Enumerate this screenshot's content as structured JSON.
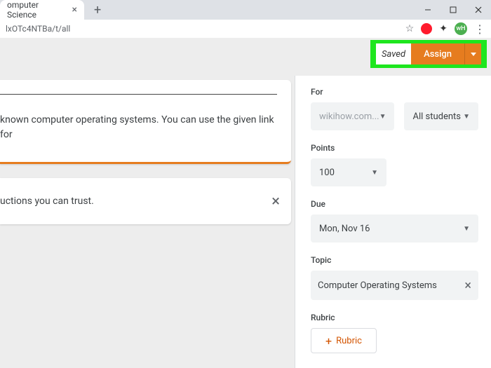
{
  "browser": {
    "tab_title": "omputer Science",
    "url_fragment": "lxOTc4NTBa/t/all",
    "avatar_initials": "wH"
  },
  "header": {
    "saved_label": "Saved",
    "assign_label": "Assign"
  },
  "left": {
    "instructions": "known computer operating systems. You can use the given link for",
    "trust_text": "uctions you can trust."
  },
  "right": {
    "for_label": "For",
    "class_value": "wikihow.com...",
    "students_value": "All students",
    "points_label": "Points",
    "points_value": "100",
    "due_label": "Due",
    "due_value": "Mon, Nov 16",
    "topic_label": "Topic",
    "topic_value": "Computer Operating Systems",
    "rubric_label": "Rubric",
    "rubric_btn": "Rubric"
  }
}
